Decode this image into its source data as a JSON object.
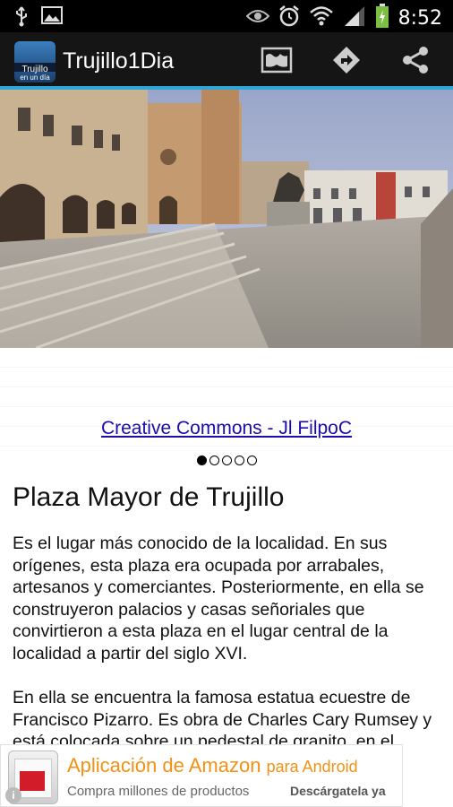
{
  "status_bar": {
    "time": "8:52",
    "left_icons": [
      "usb-icon",
      "image-icon"
    ],
    "right_icons": [
      "eye-icon",
      "alarm-clock-icon",
      "wifi-icon",
      "signal-icon",
      "battery-charging-icon"
    ]
  },
  "action_bar": {
    "logo_line1": "Trujillo",
    "logo_line2": "en un día",
    "title": "Trujillo1Dia",
    "actions": [
      "map-icon",
      "directions-icon",
      "share-icon"
    ],
    "accent_color": "#2fa6d8"
  },
  "photo": {
    "credit": "Creative Commons - Jl FilpoC",
    "pages_total": 5,
    "page_current": 1
  },
  "place": {
    "title": "Plaza Mayor de Trujillo",
    "paragraph1": "Es el lugar más conocido de la localidad. En sus orígenes, esta plaza era ocupada por arrabales, artesanos y comerciantes. Posteriormente, en ella se construyeron palacios y casas señoriales que convirtieron a esta plaza en el lugar central de la localidad a partir del siglo XVI.",
    "paragraph2": "En ella se encuentra la famosa estatua ecuestre de Francisco Pizarro. Es obra de Charles Cary Rumsey y está colocada sobre un pedestal de granito, en el centro de la plaza. Es un emblema nacional. Las"
  },
  "ad": {
    "title_main": "Aplicación de Amazon",
    "title_small": "para Android",
    "subtitle": "Compra millones de productos",
    "cta": "Descárgatela ya",
    "title_color": "#f29113"
  }
}
